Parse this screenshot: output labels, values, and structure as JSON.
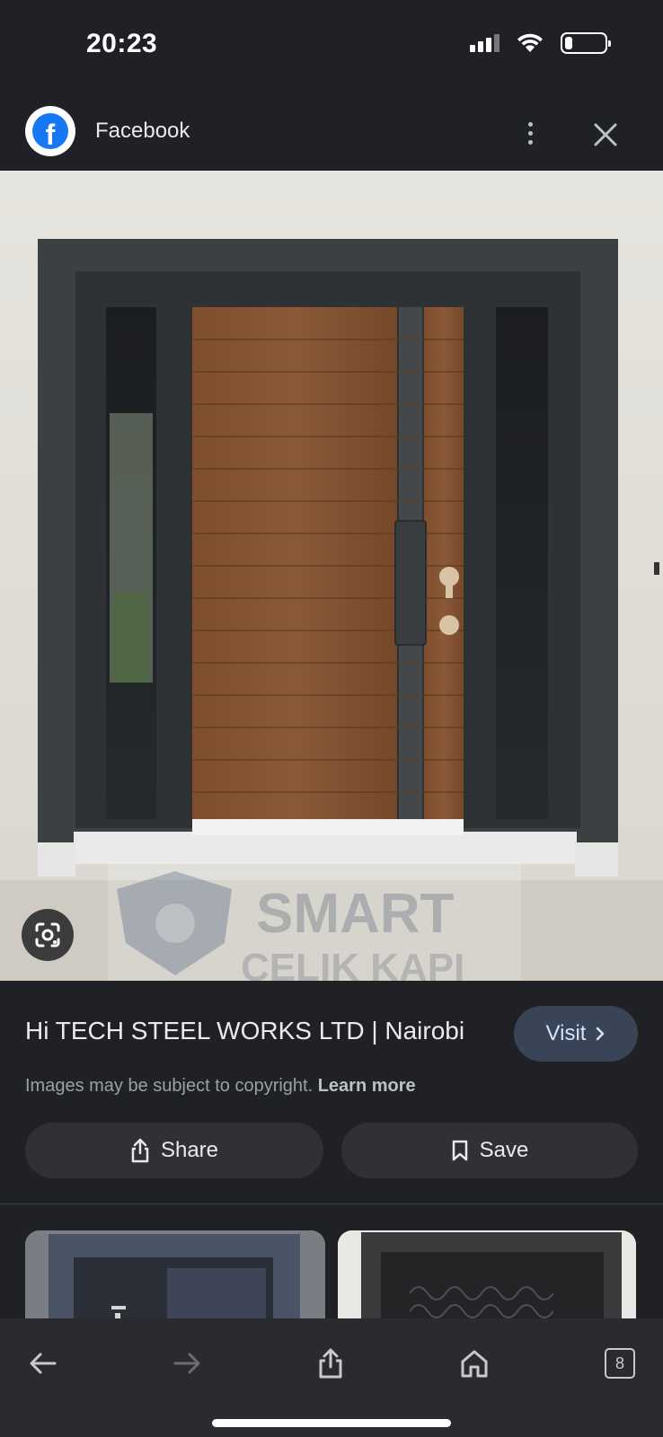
{
  "status_bar": {
    "time": "20:23",
    "battery_level_fraction": 0.2
  },
  "source": {
    "name": "Facebook",
    "logo_letter": "f"
  },
  "image": {
    "watermark_line1": "SMART",
    "watermark_line2": "CELIK KAPI",
    "colors": {
      "frame": "#3f4245",
      "wood": "#7a4c2c",
      "wall": "#e4e2dc"
    }
  },
  "result": {
    "title": "Hi TECH STEEL WORKS LTD | Nairobi",
    "visit_label": "Visit",
    "copyright_text": "Images may be subject to copyright.",
    "learn_more_label": "Learn more"
  },
  "actions": {
    "share_label": "Share",
    "save_label": "Save"
  },
  "browser_toolbar": {
    "tab_count": "8"
  },
  "icons": [
    "facebook-logo",
    "more-vert-icon",
    "close-icon",
    "lens-icon",
    "chevron-right-icon",
    "share-icon",
    "bookmark-icon",
    "back-icon",
    "forward-icon",
    "home-icon"
  ]
}
